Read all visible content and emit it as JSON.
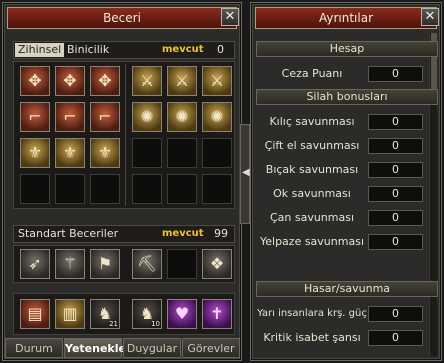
{
  "left": {
    "title": "Beceri",
    "close": "✕",
    "mini_tabs": [
      "Zihinsel",
      "Binicilik"
    ],
    "mevcut_label": "mevcut",
    "mevcut_value": "0",
    "group_label": "Standart Beceriler",
    "group_mevcut_label": "mevcut",
    "group_mevcut_value": "99",
    "bottom_tabs": [
      "Durum",
      "Yetenekler",
      "Duygular",
      "Görevler"
    ],
    "active_bottom_tab": "Yetenekler"
  },
  "right": {
    "title": "Ayrıntılar",
    "close": "✕",
    "sections": [
      {
        "heading": "Hesap",
        "rows": [
          {
            "label": "Ceza Puanı",
            "value": "0"
          }
        ]
      },
      {
        "heading": "Silah bonusları",
        "rows": [
          {
            "label": "Kılıç savunması",
            "value": "0"
          },
          {
            "label": "Çift el savunması",
            "value": "0"
          },
          {
            "label": "Bıçak savunması",
            "value": "0"
          },
          {
            "label": "Ok savunması",
            "value": "0"
          },
          {
            "label": "Çan savunması",
            "value": "0"
          },
          {
            "label": "Yelpaze savunması",
            "value": "0"
          }
        ]
      },
      {
        "heading": "Hasar/savunma",
        "rows": [
          {
            "label": "Yarı insanlara krş. güç",
            "value": "0"
          },
          {
            "label": "Kritik isabet şansı",
            "value": "0"
          }
        ]
      }
    ]
  },
  "skills": {
    "row1": [
      "shuriken-icon",
      "shuriken-icon",
      "shuriken-icon",
      "sword-icon",
      "sword-icon",
      "sword-icon"
    ],
    "row2": [
      "boot-icon",
      "boot-icon",
      "boot-icon",
      "rune-icon",
      "rune-icon",
      "rune-icon"
    ],
    "row3": [
      "dagger-icon",
      "dagger-icon",
      "dagger-icon"
    ],
    "standard": [
      "feather-icon",
      "net-icon",
      "flag-icon",
      "pickaxe-icon",
      "knot-icon"
    ],
    "standard_levels": [
      "",
      "",
      "",
      "",
      ""
    ],
    "special": [
      "book-icon",
      "scroll-icon",
      "horse-icon",
      "horse-icon",
      "heart-icon",
      "cross-icon"
    ],
    "special_levels": [
      "",
      "",
      "21",
      "10",
      "",
      ""
    ]
  }
}
